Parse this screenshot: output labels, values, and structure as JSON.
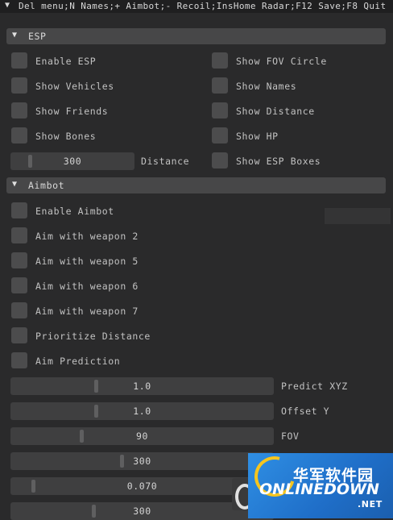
{
  "title_bar": "Del menu;N Names;+ Aimbot;- Recoil;InsHome Radar;F12 Save;F8 Quit",
  "esp": {
    "header": "ESP",
    "enable_esp": "Enable ESP",
    "show_vehicles": "Show Vehicles",
    "show_friends": "Show Friends",
    "show_bones": "Show Bones",
    "show_fov_circle": "Show FOV Circle",
    "show_names": "Show Names",
    "show_distance": "Show Distance",
    "show_hp": "Show HP",
    "show_esp_boxes": "Show ESP Boxes",
    "distance_slider": {
      "value": "300",
      "label": "Distance",
      "fraction": 0.13
    }
  },
  "aimbot": {
    "header": "Aimbot",
    "enable_aimbot": "Enable Aimbot",
    "aim_weapon_2": "Aim with weapon 2",
    "aim_weapon_5": "Aim with weapon 5",
    "aim_weapon_6": "Aim with weapon 6",
    "aim_weapon_7": "Aim with weapon 7",
    "prioritize_distance": "Prioritize Distance",
    "aim_prediction": "Aim Prediction",
    "sliders": [
      {
        "value": "1.0",
        "label": "Predict XYZ",
        "fraction": 0.32
      },
      {
        "value": "1.0",
        "label": "Offset Y",
        "fraction": 0.32
      },
      {
        "value": "90",
        "label": "FOV",
        "fraction": 0.26
      },
      {
        "value": "300",
        "label": "",
        "fraction": 0.42
      },
      {
        "value": "0.070",
        "label": "",
        "fraction": 0.07
      },
      {
        "value": "300",
        "label": "",
        "fraction": 0.31
      }
    ]
  },
  "watermark": {
    "chinese": "华军软件园",
    "brand": "ONLINEDOWN",
    "suffix": ".NET"
  },
  "colors": {
    "background": "#2a2a2b",
    "header": "#474748",
    "checkbox": "#4c4c4d",
    "slider": "#3f3f40",
    "watermark_blue": "#2f8fe4"
  }
}
